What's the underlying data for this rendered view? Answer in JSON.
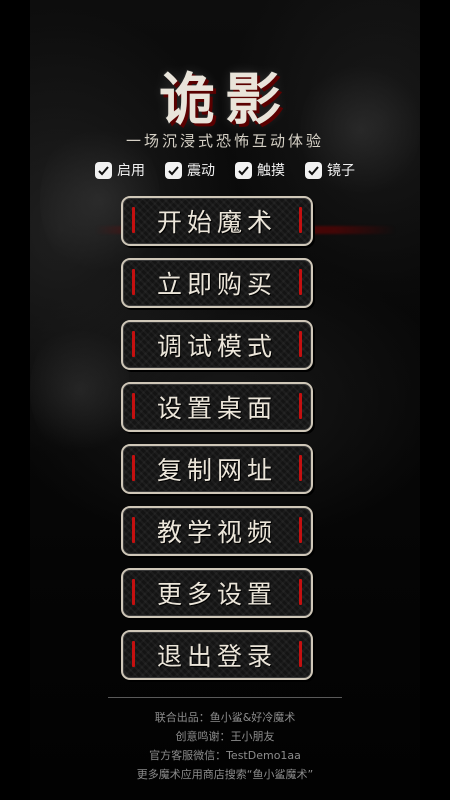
{
  "app": {
    "title": "诡影",
    "subtitle": "一场沉浸式恐怖互动体验"
  },
  "options": [
    {
      "label": "启用",
      "checked": true
    },
    {
      "label": "震动",
      "checked": true
    },
    {
      "label": "触摸",
      "checked": true
    },
    {
      "label": "镜子",
      "checked": true
    }
  ],
  "menu": [
    {
      "label": "开始魔术"
    },
    {
      "label": "立即购买"
    },
    {
      "label": "调试模式"
    },
    {
      "label": "设置桌面"
    },
    {
      "label": "复制网址"
    },
    {
      "label": "教学视频"
    },
    {
      "label": "更多设置"
    },
    {
      "label": "退出登录"
    }
  ],
  "footer": {
    "line1": "联合出品：鱼小鲨&好冷魔术",
    "line2": "创意鸣谢：王小朋友",
    "line3": "官方客服微信：TestDemo1aa",
    "line4": "更多魔术应用商店搜索“鱼小鲨魔术”"
  },
  "colors": {
    "accent_red": "#c41010",
    "button_border": "#cfc7b8",
    "background": "#050505"
  },
  "icons": {
    "checkbox": "checkmark-icon",
    "button_bars": "red-bar-icon"
  }
}
